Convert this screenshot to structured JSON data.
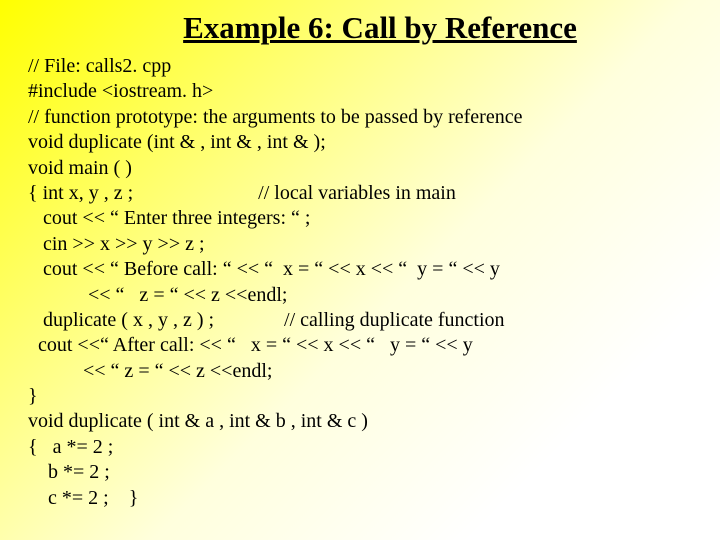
{
  "title": "Example 6: Call by Reference",
  "lines": [
    "// File: calls2. cpp",
    "#include <iostream. h>",
    "// function prototype: the arguments to be passed by reference",
    "void duplicate (int & , int & , int & );",
    "void main ( )",
    "{ int x, y , z ;                         // local variables in main",
    "   cout << “ Enter three integers: “ ;",
    "   cin >> x >> y >> z ;",
    "   cout << “ Before call: “ << “  x = “ << x << “  y = “ << y",
    "            << “   z = “ << z <<endl;",
    "   duplicate ( x , y , z ) ;              // calling duplicate function",
    "  cout <<“ After call: << “   x = “ << x << “   y = “ << y",
    "           << “ z = “ << z <<endl;",
    "}",
    "void duplicate ( int & a , int & b , int & c )",
    "{   a *= 2 ;",
    "    b *= 2 ;",
    "    c *= 2 ;    }"
  ]
}
